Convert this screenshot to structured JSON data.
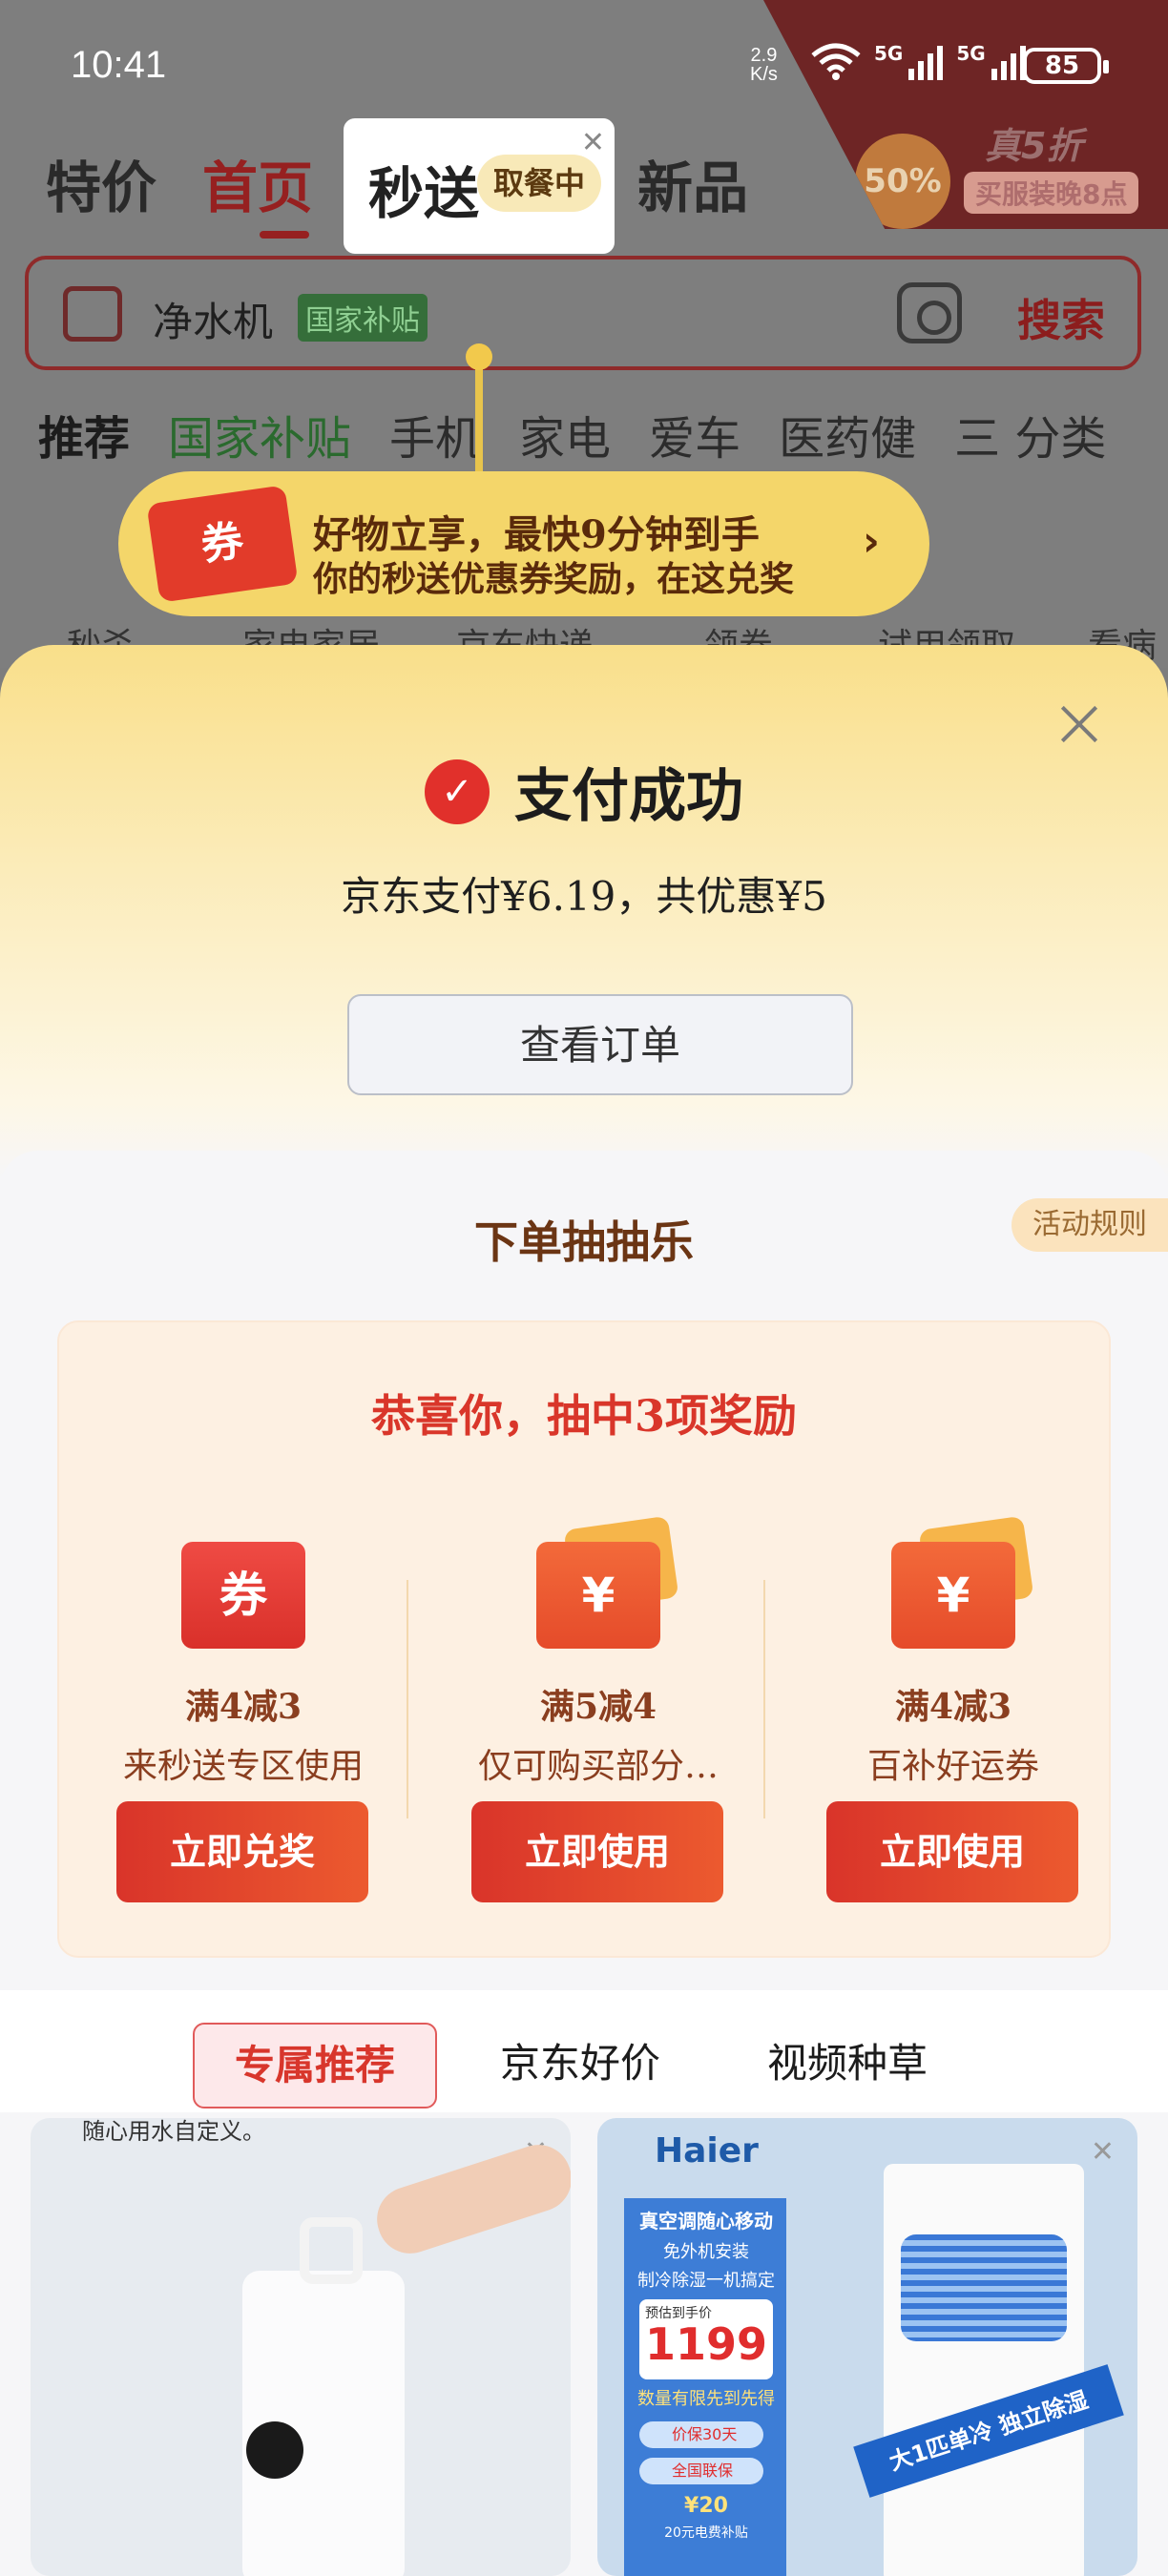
{
  "status_bar": {
    "time": "10:41",
    "net_speed": "2.9",
    "net_unit": "K/s",
    "signal1": "5G",
    "signal2": "5G",
    "battery": "85"
  },
  "promo_corner": {
    "badge": "50%",
    "title": "真5折",
    "subtitle": "买服装晚8点"
  },
  "top_nav": {
    "tabs": [
      "特价",
      "首页",
      "新品"
    ],
    "active": "首页",
    "instant_tab": "秒送",
    "instant_pill": "取餐中"
  },
  "search": {
    "keyword": "净水机",
    "tag": "国家补贴",
    "button": "搜索"
  },
  "categories": [
    "推荐",
    "国家补贴",
    "手机",
    "家电",
    "爱车",
    "医药健"
  ],
  "categories_more": "三 分类",
  "icon_row": [
    "秒杀",
    "家电家居",
    "京东快递",
    "领券",
    "试用领取",
    "看病"
  ],
  "banner": {
    "coupon": "券",
    "line1": "好物立享，最快9分钟到手",
    "line2": "你的秒送优惠券奖励，在这兑奖"
  },
  "sheet": {
    "title": "支付成功",
    "summary": "京东支付¥6.19，共优惠¥5",
    "view_order": "查看订单"
  },
  "lottery": {
    "title": "下单抽抽乐",
    "rules": "活动规则",
    "congrats": "恭喜你，抽中3项奖励",
    "prizes": [
      {
        "icon": "券",
        "line1": "满4减3",
        "line2": "来秒送专区使用",
        "button": "立即兑奖"
      },
      {
        "icon": "¥",
        "line1": "满5减4",
        "line2": "仅可购买部分…",
        "button": "立即使用"
      },
      {
        "icon": "¥",
        "line1": "满4减3",
        "line2": "百补好运券",
        "button": "立即使用"
      }
    ]
  },
  "feed_tabs": [
    "专属推荐",
    "京东好价",
    "视频种草"
  ],
  "feed": {
    "card1_caption": "随心用水自定义。",
    "card2": {
      "brand": "Haier",
      "headline": "真空调随心移动",
      "points": [
        "免外机安装",
        "制冷除湿一机搞定"
      ],
      "price_label": "预估到手价",
      "price": "1199",
      "price_note": "数量有限先到先得",
      "checks": [
        "价保30天",
        "全国联保"
      ],
      "gift": "¥20",
      "gift_note": "20元电费补贴",
      "ribbon": "大1匹单冷  独立除湿"
    }
  }
}
